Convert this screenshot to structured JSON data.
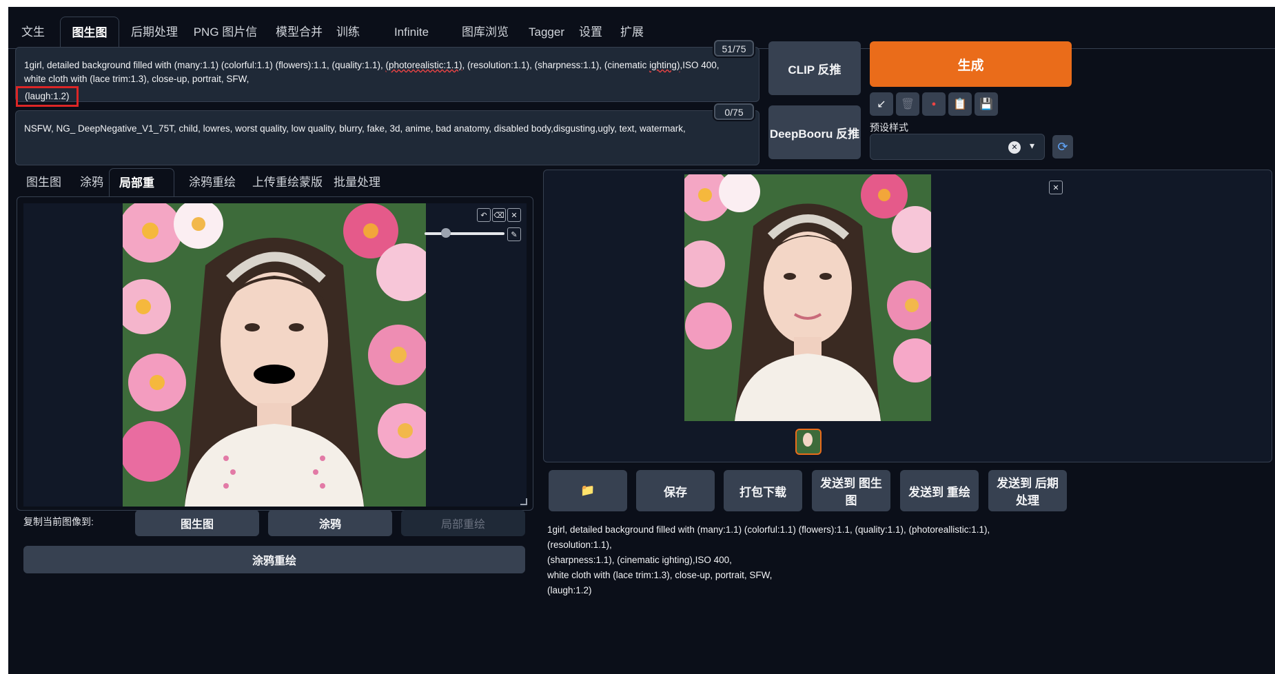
{
  "top_tabs": [
    "文生图",
    "图生图",
    "后期处理",
    "PNG 图片信息",
    "模型合并",
    "训练",
    "Infinite Zoom",
    "图库浏览器",
    "Tagger",
    "设置",
    "扩展"
  ],
  "prompt": {
    "line1": "1girl, detailed background filled with (many:1.1) (colorful:1.1) (flowers):1.1, (quality:1.1), ",
    "line1_underlined": "(photorealistic:1.1)",
    "line1_rest": ", (resolution:1.1), (sharpness:1.1), (cinematic ",
    "line1_underlined2": "ighting)",
    "line1_end": ",ISO 400,",
    "line2": "white cloth with (lace trim:1.3), close-up, portrait, SFW,",
    "line3": "(laugh:1.2)",
    "token_count": "51/75"
  },
  "negative_prompt": {
    "text": "NSFW, NG_ DeepNegative_V1_75T, child, lowres, worst quality, low quality, blurry, fake, 3d, anime, bad anatomy, disabled body,disgusting,ugly, text, watermark,",
    "token_count": "0/75"
  },
  "buttons": {
    "clip": "CLIP 反推",
    "deepbooru": "DeepBooru 反推",
    "generate": "生成"
  },
  "tool_icons": [
    "↙",
    "🗑",
    "●",
    "📋",
    "💾"
  ],
  "styles": {
    "label": "预设样式",
    "clear": "✕",
    "caret": "▾",
    "refresh": "⟳"
  },
  "sub_tabs": [
    "图生图",
    "涂鸦",
    "局部重绘",
    "涂鸦重绘",
    "上传重绘蒙版",
    "批量处理"
  ],
  "canvas_icons": {
    "undo": "↶",
    "clear": "⌫",
    "close": "✕",
    "brush": "✎"
  },
  "copy_to": {
    "label": "复制当前图像到:",
    "img2img": "图生图",
    "sketch": "涂鸦",
    "inpaint": "局部重绘"
  },
  "inpaint_sketch_button": "涂鸦重绘",
  "output_close": "✕",
  "output_buttons": [
    "📁",
    "保存",
    "打包下载",
    "发送到 图生图",
    "发送到 重绘",
    "发送到 后期处理"
  ],
  "output_info": {
    "line1": "1girl, detailed background filled with (many:1.1) (colorful:1.1) (flowers):1.1, (quality:1.1), (photoreallistic:1.1), (resolution:1.1),",
    "line2": "(sharpness:1.1), (cinematic ighting),ISO 400,",
    "line3": "white cloth with (lace trim:1.3), close-up, portrait, SFW,",
    "line4": "(laugh:1.2)"
  }
}
